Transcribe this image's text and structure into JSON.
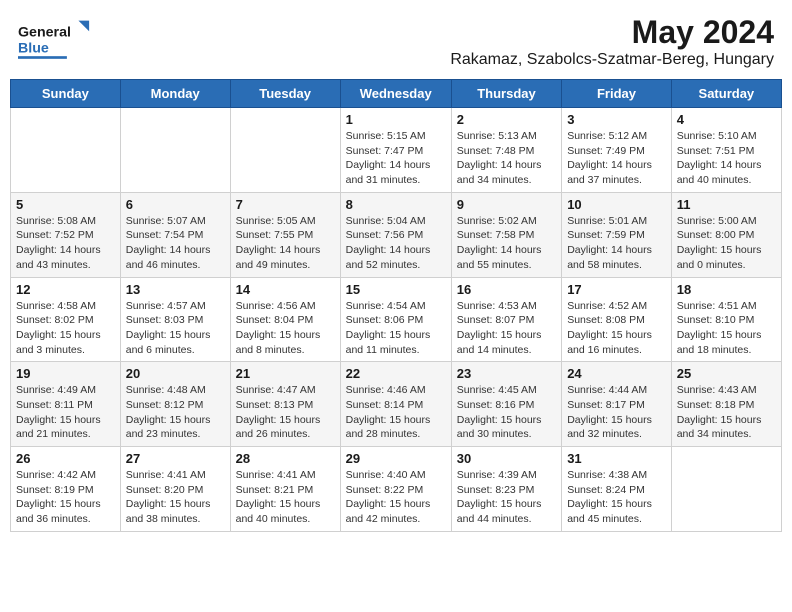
{
  "header": {
    "logo_text_general": "General",
    "logo_text_blue": "Blue",
    "title": "May 2024",
    "subtitle": "Rakamaz, Szabolcs-Szatmar-Bereg, Hungary"
  },
  "days_of_week": [
    "Sunday",
    "Monday",
    "Tuesday",
    "Wednesday",
    "Thursday",
    "Friday",
    "Saturday"
  ],
  "weeks": [
    [
      {
        "day": "",
        "sunrise": "",
        "sunset": "",
        "daylight": ""
      },
      {
        "day": "",
        "sunrise": "",
        "sunset": "",
        "daylight": ""
      },
      {
        "day": "",
        "sunrise": "",
        "sunset": "",
        "daylight": ""
      },
      {
        "day": "1",
        "sunrise": "Sunrise: 5:15 AM",
        "sunset": "Sunset: 7:47 PM",
        "daylight": "Daylight: 14 hours and 31 minutes."
      },
      {
        "day": "2",
        "sunrise": "Sunrise: 5:13 AM",
        "sunset": "Sunset: 7:48 PM",
        "daylight": "Daylight: 14 hours and 34 minutes."
      },
      {
        "day": "3",
        "sunrise": "Sunrise: 5:12 AM",
        "sunset": "Sunset: 7:49 PM",
        "daylight": "Daylight: 14 hours and 37 minutes."
      },
      {
        "day": "4",
        "sunrise": "Sunrise: 5:10 AM",
        "sunset": "Sunset: 7:51 PM",
        "daylight": "Daylight: 14 hours and 40 minutes."
      }
    ],
    [
      {
        "day": "5",
        "sunrise": "Sunrise: 5:08 AM",
        "sunset": "Sunset: 7:52 PM",
        "daylight": "Daylight: 14 hours and 43 minutes."
      },
      {
        "day": "6",
        "sunrise": "Sunrise: 5:07 AM",
        "sunset": "Sunset: 7:54 PM",
        "daylight": "Daylight: 14 hours and 46 minutes."
      },
      {
        "day": "7",
        "sunrise": "Sunrise: 5:05 AM",
        "sunset": "Sunset: 7:55 PM",
        "daylight": "Daylight: 14 hours and 49 minutes."
      },
      {
        "day": "8",
        "sunrise": "Sunrise: 5:04 AM",
        "sunset": "Sunset: 7:56 PM",
        "daylight": "Daylight: 14 hours and 52 minutes."
      },
      {
        "day": "9",
        "sunrise": "Sunrise: 5:02 AM",
        "sunset": "Sunset: 7:58 PM",
        "daylight": "Daylight: 14 hours and 55 minutes."
      },
      {
        "day": "10",
        "sunrise": "Sunrise: 5:01 AM",
        "sunset": "Sunset: 7:59 PM",
        "daylight": "Daylight: 14 hours and 58 minutes."
      },
      {
        "day": "11",
        "sunrise": "Sunrise: 5:00 AM",
        "sunset": "Sunset: 8:00 PM",
        "daylight": "Daylight: 15 hours and 0 minutes."
      }
    ],
    [
      {
        "day": "12",
        "sunrise": "Sunrise: 4:58 AM",
        "sunset": "Sunset: 8:02 PM",
        "daylight": "Daylight: 15 hours and 3 minutes."
      },
      {
        "day": "13",
        "sunrise": "Sunrise: 4:57 AM",
        "sunset": "Sunset: 8:03 PM",
        "daylight": "Daylight: 15 hours and 6 minutes."
      },
      {
        "day": "14",
        "sunrise": "Sunrise: 4:56 AM",
        "sunset": "Sunset: 8:04 PM",
        "daylight": "Daylight: 15 hours and 8 minutes."
      },
      {
        "day": "15",
        "sunrise": "Sunrise: 4:54 AM",
        "sunset": "Sunset: 8:06 PM",
        "daylight": "Daylight: 15 hours and 11 minutes."
      },
      {
        "day": "16",
        "sunrise": "Sunrise: 4:53 AM",
        "sunset": "Sunset: 8:07 PM",
        "daylight": "Daylight: 15 hours and 14 minutes."
      },
      {
        "day": "17",
        "sunrise": "Sunrise: 4:52 AM",
        "sunset": "Sunset: 8:08 PM",
        "daylight": "Daylight: 15 hours and 16 minutes."
      },
      {
        "day": "18",
        "sunrise": "Sunrise: 4:51 AM",
        "sunset": "Sunset: 8:10 PM",
        "daylight": "Daylight: 15 hours and 18 minutes."
      }
    ],
    [
      {
        "day": "19",
        "sunrise": "Sunrise: 4:49 AM",
        "sunset": "Sunset: 8:11 PM",
        "daylight": "Daylight: 15 hours and 21 minutes."
      },
      {
        "day": "20",
        "sunrise": "Sunrise: 4:48 AM",
        "sunset": "Sunset: 8:12 PM",
        "daylight": "Daylight: 15 hours and 23 minutes."
      },
      {
        "day": "21",
        "sunrise": "Sunrise: 4:47 AM",
        "sunset": "Sunset: 8:13 PM",
        "daylight": "Daylight: 15 hours and 26 minutes."
      },
      {
        "day": "22",
        "sunrise": "Sunrise: 4:46 AM",
        "sunset": "Sunset: 8:14 PM",
        "daylight": "Daylight: 15 hours and 28 minutes."
      },
      {
        "day": "23",
        "sunrise": "Sunrise: 4:45 AM",
        "sunset": "Sunset: 8:16 PM",
        "daylight": "Daylight: 15 hours and 30 minutes."
      },
      {
        "day": "24",
        "sunrise": "Sunrise: 4:44 AM",
        "sunset": "Sunset: 8:17 PM",
        "daylight": "Daylight: 15 hours and 32 minutes."
      },
      {
        "day": "25",
        "sunrise": "Sunrise: 4:43 AM",
        "sunset": "Sunset: 8:18 PM",
        "daylight": "Daylight: 15 hours and 34 minutes."
      }
    ],
    [
      {
        "day": "26",
        "sunrise": "Sunrise: 4:42 AM",
        "sunset": "Sunset: 8:19 PM",
        "daylight": "Daylight: 15 hours and 36 minutes."
      },
      {
        "day": "27",
        "sunrise": "Sunrise: 4:41 AM",
        "sunset": "Sunset: 8:20 PM",
        "daylight": "Daylight: 15 hours and 38 minutes."
      },
      {
        "day": "28",
        "sunrise": "Sunrise: 4:41 AM",
        "sunset": "Sunset: 8:21 PM",
        "daylight": "Daylight: 15 hours and 40 minutes."
      },
      {
        "day": "29",
        "sunrise": "Sunrise: 4:40 AM",
        "sunset": "Sunset: 8:22 PM",
        "daylight": "Daylight: 15 hours and 42 minutes."
      },
      {
        "day": "30",
        "sunrise": "Sunrise: 4:39 AM",
        "sunset": "Sunset: 8:23 PM",
        "daylight": "Daylight: 15 hours and 44 minutes."
      },
      {
        "day": "31",
        "sunrise": "Sunrise: 4:38 AM",
        "sunset": "Sunset: 8:24 PM",
        "daylight": "Daylight: 15 hours and 45 minutes."
      },
      {
        "day": "",
        "sunrise": "",
        "sunset": "",
        "daylight": ""
      }
    ]
  ]
}
